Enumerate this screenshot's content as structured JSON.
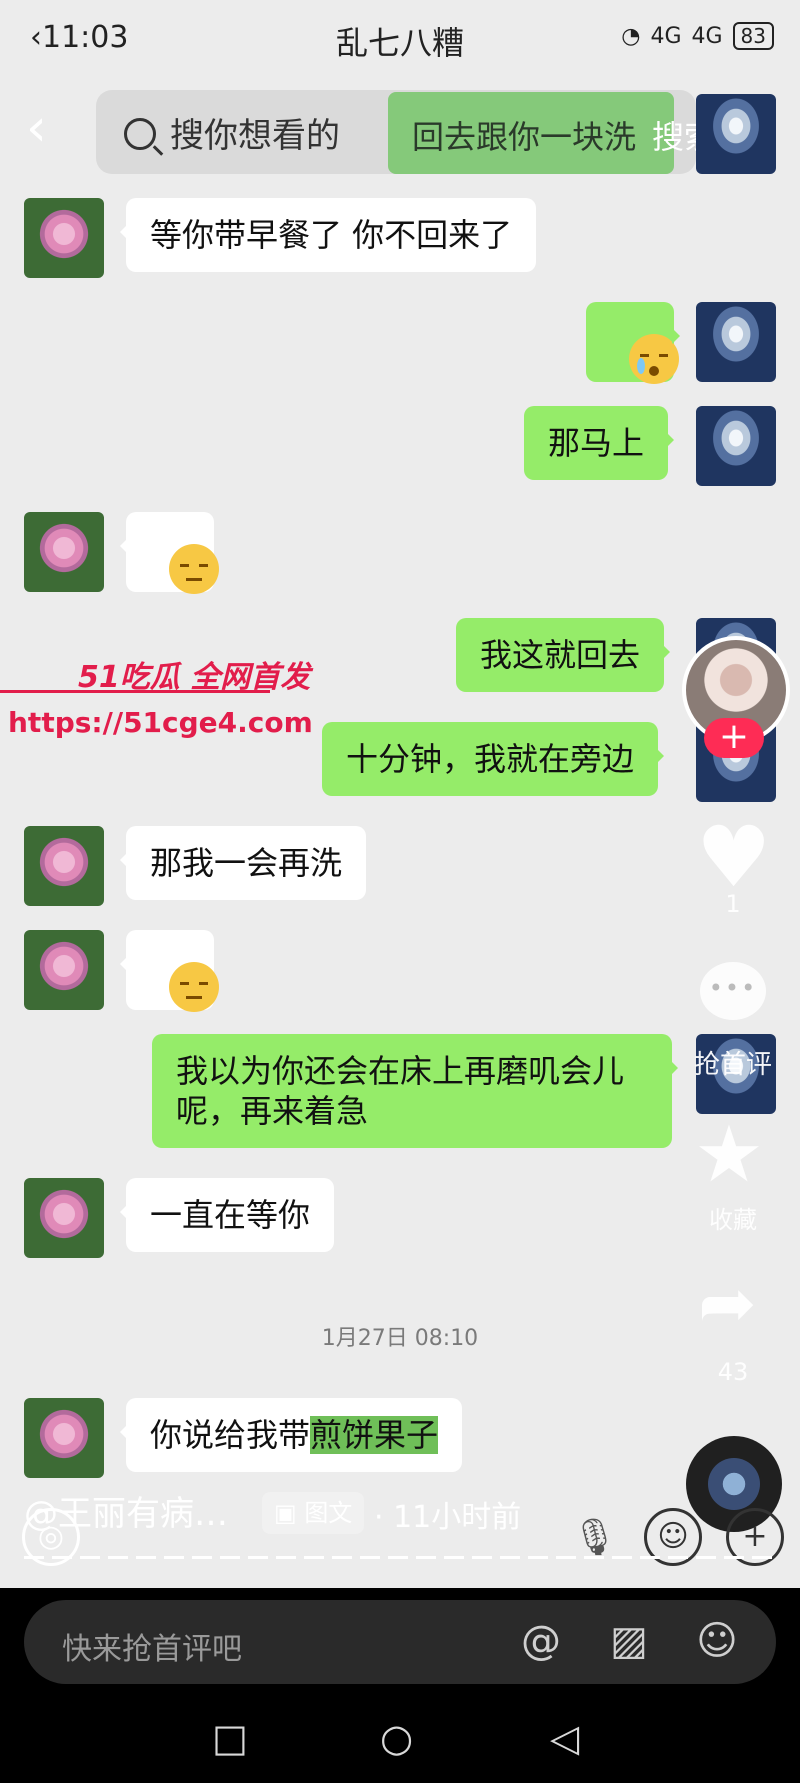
{
  "status_bar": {
    "time": "11:03",
    "title": "乱七八糟",
    "signal": "4G",
    "signal2": "4G",
    "battery": "83"
  },
  "search": {
    "placeholder": "搜你想看的",
    "suggestion": "回去跟你一块洗",
    "submit": "搜索"
  },
  "messages": [
    {
      "side": "in",
      "text": "等你带早餐了 你不回来了"
    },
    {
      "side": "out",
      "emoji": "crying-face"
    },
    {
      "side": "out",
      "text": "那马上"
    },
    {
      "side": "in",
      "emoji": "relieved-face"
    },
    {
      "side": "out",
      "text": "我这就回去"
    },
    {
      "side": "out",
      "text": "十分钟，我就在旁边"
    },
    {
      "side": "in",
      "text": "那我一会再洗"
    },
    {
      "side": "in",
      "emoji": "relieved-face"
    },
    {
      "side": "out",
      "text": "我以为你还会在床上再磨叽会儿呢，再来着急"
    },
    {
      "side": "in",
      "text": "一直在等你"
    },
    {
      "side": "in",
      "text_plain": "你说给我带",
      "text_highlight": "煎饼果子"
    }
  ],
  "timestamp": "1月27日 08:10",
  "watermark": {
    "line1": "51吃瓜 全网首发",
    "line2": "https://51cge4.com"
  },
  "sidebar": {
    "follow": "+",
    "like_count": "1",
    "comment_label": "抢首评",
    "favorite_label": "收藏",
    "share_count": "43"
  },
  "post_info": {
    "author": "@王丽有病…",
    "tag": "图文",
    "separator": "·",
    "time_ago": "11小时前"
  },
  "comment_bar": {
    "placeholder": "快来抢首评吧"
  },
  "icons": {
    "back": "chevron-left-icon",
    "search": "search-icon",
    "at": "at-icon",
    "image": "image-icon",
    "emoji": "emoji-icon",
    "mic": "mic-icon",
    "add": "plus-icon"
  }
}
